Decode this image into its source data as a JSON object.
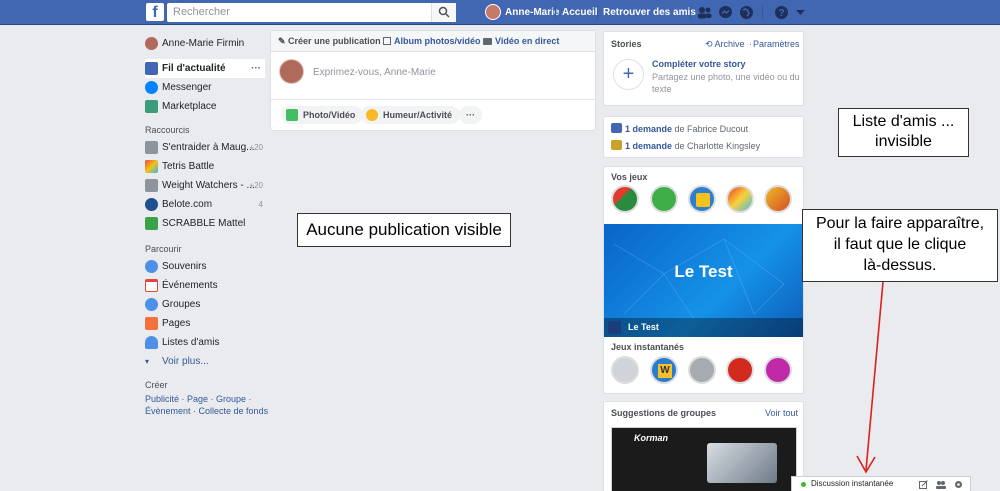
{
  "topbar": {
    "logo": "f",
    "search_placeholder": "Rechercher",
    "user_name": "Anne-Marie",
    "home": "Accueil",
    "find_friends": "Retrouver des amis"
  },
  "left": {
    "user": "Anne-Marie Firmin",
    "news_feed": "Fil d'actualité",
    "news_more": "···",
    "messenger": "Messenger",
    "marketplace": "Marketplace",
    "shortcuts_title": "Raccourcis",
    "shortcuts": [
      {
        "label": "S'entraider à Maug...",
        "count": "+20"
      },
      {
        "label": "Tetris Battle",
        "count": ""
      },
      {
        "label": "Weight Watchers - ...",
        "count": "+20"
      },
      {
        "label": "Belote.com",
        "count": "4"
      },
      {
        "label": "SCRABBLE Mattel",
        "count": ""
      }
    ],
    "explore_title": "Parcourir",
    "explore": [
      {
        "label": "Souvenirs"
      },
      {
        "label": "Événements"
      },
      {
        "label": "Groupes"
      },
      {
        "label": "Pages"
      },
      {
        "label": "Listes d'amis"
      }
    ],
    "see_more": "Voir plus...",
    "create_title": "Créer",
    "create_links_1": "Publicité · Page · Groupe ·",
    "create_links_2": "Évènement · Collecte de fonds"
  },
  "composer": {
    "tab_create": "Créer une publication",
    "tab_album": "Album photos/vidéo",
    "tab_live": "Vidéo en direct",
    "placeholder": "Exprimez-vous, Anne-Marie",
    "photo_video": "Photo/Vidéo",
    "mood": "Humeur/Activité",
    "more": "···"
  },
  "stories": {
    "title": "Stories",
    "archive": "Archive",
    "settings": "Paramètres",
    "complete": "Compléter votre story",
    "subtitle": "Partagez une photo, une vidéo ou du texte"
  },
  "requests": [
    {
      "count": "1 demande",
      "from": "de Fabrice Ducout"
    },
    {
      "count": "1 demande",
      "from": "de Charlotte Kingsley"
    }
  ],
  "games": {
    "title": "Vos jeux",
    "banner_title": "Le Test",
    "banner_caption": "Le Test",
    "instant_title": "Jeux instantanés"
  },
  "groups": {
    "title": "Suggestions de groupes",
    "see_all": "Voir tout",
    "ad_brand": "Korman"
  },
  "annotations": {
    "note1": "Aucune publication visible",
    "note2": "Liste d'amis ...\n  invisible",
    "note3": "Pour la faire apparaître,\nil faut que le clique\nlà-dessus."
  },
  "chat": {
    "label": "Discussion instantanée"
  },
  "colors": {
    "brand": "#4267b2",
    "background": "#e9ebee",
    "link": "#365899",
    "online": "#42b72a",
    "annotation_arrow": "#e0201b"
  }
}
